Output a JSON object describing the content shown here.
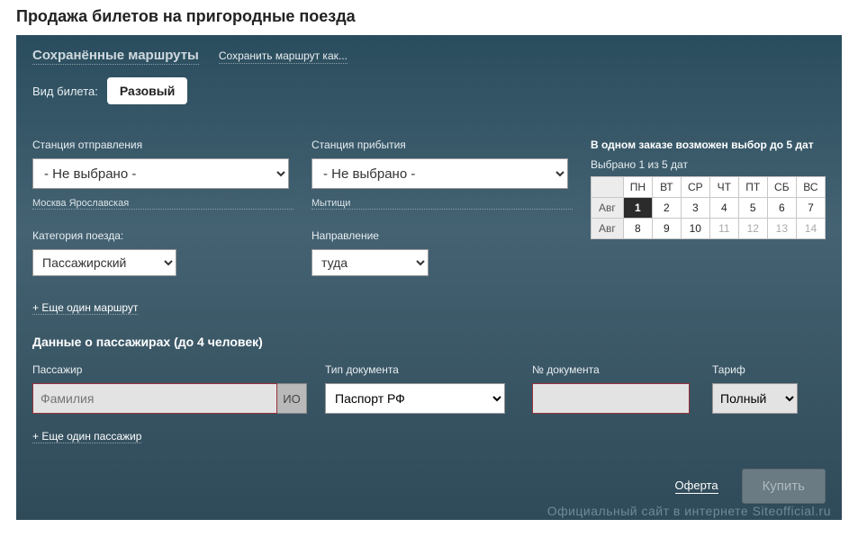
{
  "page_title": "Продажа билетов на пригородные поезда",
  "top": {
    "saved_routes": "Сохранённые маршруты",
    "save_route_as": "Сохранить маршрут как..."
  },
  "ticket_type": {
    "label": "Вид билета:",
    "value": "Разовый"
  },
  "stations": {
    "departure_label": "Станция отправления",
    "departure_value": "- Не выбрано -",
    "departure_hint": "Москва Ярославская",
    "arrival_label": "Станция прибытия",
    "arrival_value": "- Не выбрано -",
    "arrival_hint": "Мытищи"
  },
  "train_category": {
    "label": "Категория поезда:",
    "value": "Пассажирский"
  },
  "direction": {
    "label": "Направление",
    "value": "туда"
  },
  "dates": {
    "info": "В одном заказе возможен выбор до 5 дат",
    "selected": "Выбрано 1 из 5 дат",
    "weekdays": [
      "ПН",
      "ВТ",
      "СР",
      "ЧТ",
      "ПТ",
      "СБ",
      "ВС"
    ],
    "rows": [
      {
        "month": "Авг",
        "days": [
          {
            "d": "1",
            "sel": true
          },
          {
            "d": "2"
          },
          {
            "d": "3"
          },
          {
            "d": "4"
          },
          {
            "d": "5"
          },
          {
            "d": "6"
          },
          {
            "d": "7"
          }
        ]
      },
      {
        "month": "Авг",
        "days": [
          {
            "d": "8"
          },
          {
            "d": "9"
          },
          {
            "d": "10"
          },
          {
            "d": "11",
            "dis": true
          },
          {
            "d": "12",
            "dis": true
          },
          {
            "d": "13",
            "dis": true
          },
          {
            "d": "14",
            "dis": true
          }
        ]
      }
    ]
  },
  "add_route": "+ Еще один маршрут",
  "passengers": {
    "title": "Данные о пассажирах (до 4 человек)",
    "col_passenger": "Пассажир",
    "col_doc_type": "Тип документа",
    "col_doc_num": "№ документа",
    "col_tariff": "Тариф",
    "surname_placeholder": "Фамилия",
    "io_btn": "ИО",
    "doc_type_value": "Паспорт РФ",
    "tariff_value": "Полный",
    "add_passenger": "+ Еще один пассажир"
  },
  "footer": {
    "oferta": "Оферта",
    "buy": "Купить"
  },
  "watermark": "Официальный сайт в интернете Siteofficial.ru"
}
